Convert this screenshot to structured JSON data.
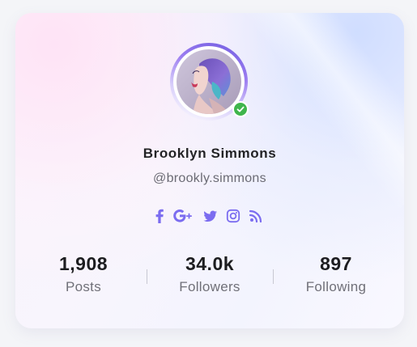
{
  "profile": {
    "name": "Brooklyn Simmons",
    "handle": "@brookly.simmons",
    "verified": true
  },
  "social_links": [
    {
      "icon": "facebook-icon"
    },
    {
      "icon": "google-plus-icon"
    },
    {
      "icon": "twitter-icon"
    },
    {
      "icon": "instagram-icon"
    },
    {
      "icon": "rss-icon"
    }
  ],
  "stats": [
    {
      "value": "1,908",
      "label": "Posts"
    },
    {
      "value": "34.0k",
      "label": "Followers"
    },
    {
      "value": "897",
      "label": "Following"
    }
  ],
  "colors": {
    "accent": "#7b6cf0",
    "verified_badge": "#3fb54c",
    "name_text": "#232325",
    "muted_text": "#6b6b74"
  }
}
